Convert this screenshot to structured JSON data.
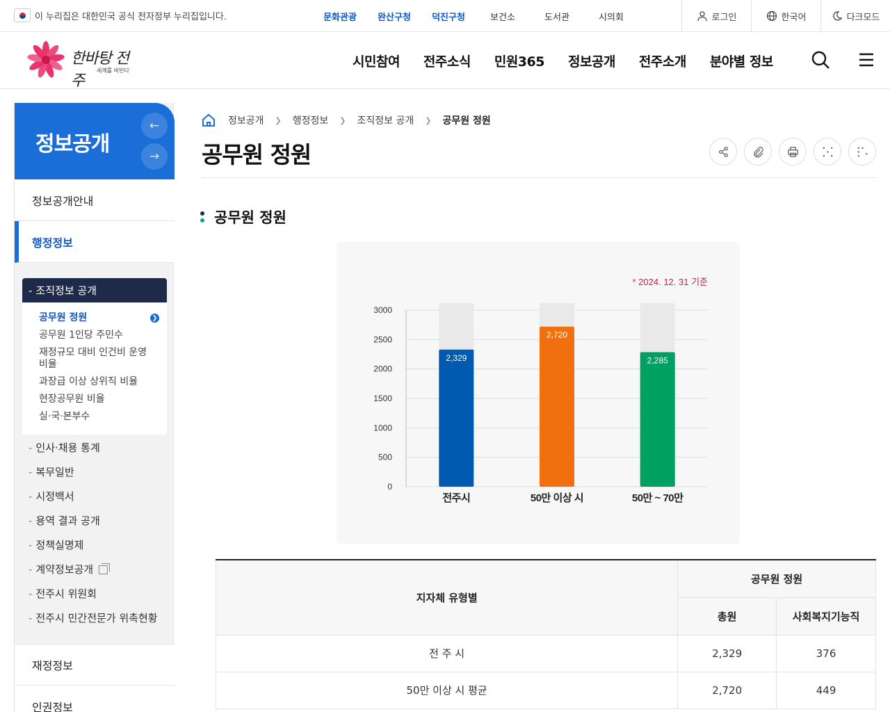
{
  "topbar": {
    "notice": "이 누리집은 대한민국 공식 전자정부 누리집입니다.",
    "sites": [
      {
        "label": "문화관광",
        "hl": true
      },
      {
        "label": "완산구청",
        "hl": true
      },
      {
        "label": "덕진구청",
        "hl": true
      },
      {
        "label": "보건소",
        "hl": false
      },
      {
        "label": "도서관",
        "hl": false
      },
      {
        "label": "시의회",
        "hl": false
      }
    ],
    "login": "로그인",
    "language": "한국어",
    "darkmode": "다크모드"
  },
  "header": {
    "logo_text": "한바탕 전주",
    "logo_sub": "세계를 비빈다",
    "nav": [
      "시민참여",
      "전주소식",
      "민원365",
      "정보공개",
      "전주소개",
      "분야별 정보"
    ],
    "search_icon": "search-icon",
    "menu_icon": "hamburger-menu-icon"
  },
  "sidebar": {
    "title": "정보공개",
    "items": [
      "정보공개안내",
      "행정정보",
      "재정정보",
      "인권정보"
    ],
    "active_item": "행정정보",
    "sub_title": "조직정보 공개",
    "sub_items": [
      "공무원 정원",
      "공무원 1인당 주민수",
      "재정규모 대비 인건비 운영비율",
      "과장급 이상 상위직 비율",
      "현장공무원 비율",
      "실·국·본부수"
    ],
    "other_items": [
      "인사·채용 통계",
      "복무일반",
      "시정백서",
      "용역 결과 공개",
      "정책실명제",
      "계약정보공개",
      "전주시 위원회",
      "전주시 민간전문가 위촉현황"
    ]
  },
  "content": {
    "breadcrumb": [
      "정보공개",
      "행정정보",
      "조직정보 공개",
      "공무원 정원"
    ],
    "page_title": "공무원 정원",
    "section_title": "공무원 정원",
    "colors": {
      "accent_blue": "#1b6ed8",
      "dot_teal": "#0aa98a",
      "dot_navy": "#1f2a4a"
    }
  },
  "chart_data": {
    "type": "bar",
    "annotation": "* 2024. 12. 31 기준",
    "categories": [
      "전주시",
      "50만 이상 시",
      "50만 ~ 70만"
    ],
    "values": [
      2329,
      2720,
      2285
    ],
    "value_labels": [
      "2,329",
      "2,720",
      "2,285"
    ],
    "colors": [
      "#005bb0",
      "#f07010",
      "#00a060"
    ],
    "ylim": [
      0,
      3000
    ],
    "yticks": [
      0,
      500,
      1000,
      1500,
      2000,
      2500,
      3000
    ],
    "grid": true,
    "title": "",
    "xlabel": "",
    "ylabel": ""
  },
  "table": {
    "col_group": "지자체 유형별",
    "header_group": "공무원 정원",
    "headers": [
      "총원",
      "사회복지기능직"
    ],
    "rows": [
      [
        "전 주 시",
        "2,329",
        "376"
      ],
      [
        "50만 이상 시 평균",
        "2,720",
        "449"
      ]
    ]
  }
}
